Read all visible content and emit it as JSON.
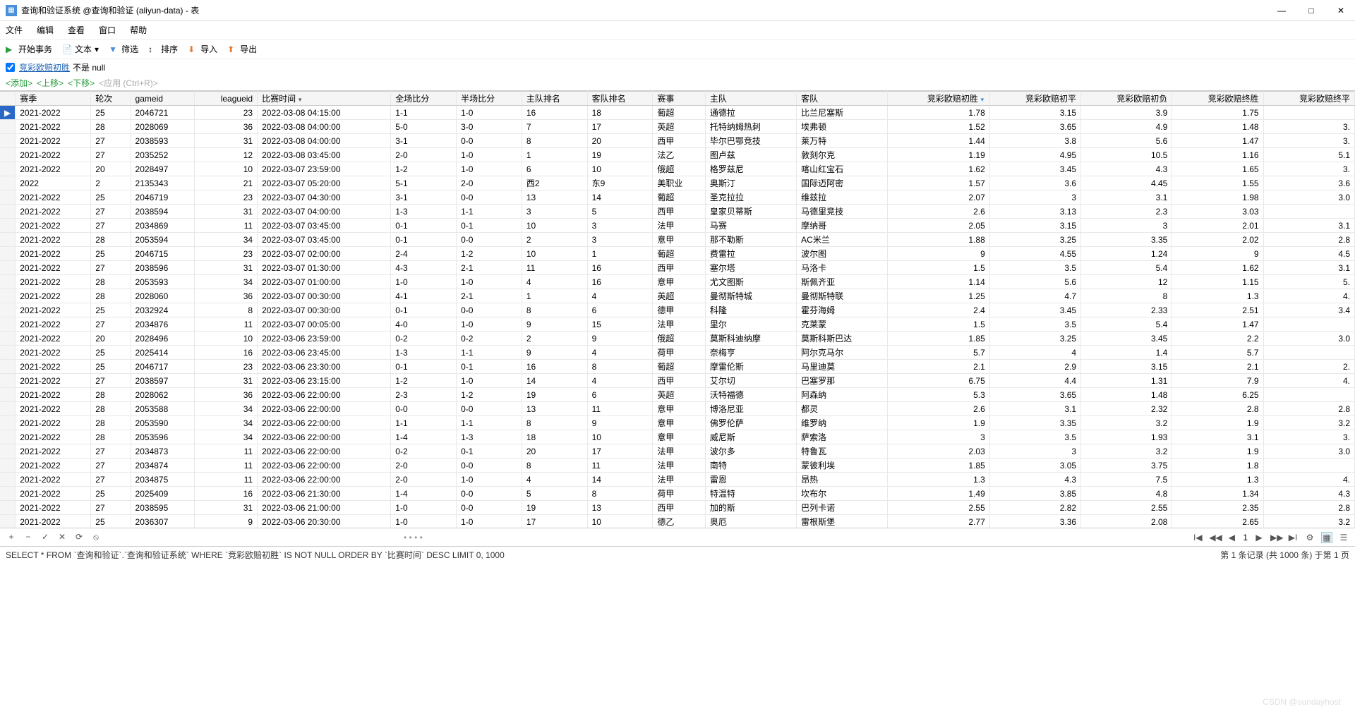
{
  "title": "查询和验证系统 @查询和验证 (aliyun-data) - 表",
  "menu": {
    "file": "文件",
    "edit": "编辑",
    "view": "查看",
    "window": "窗口",
    "help": "帮助"
  },
  "toolbar": {
    "begin": "开始事务",
    "text": "文本",
    "filter": "筛选",
    "sort": "排序",
    "import": "导入",
    "export": "导出"
  },
  "filterbar": {
    "col": "竞彩欧赔初胜",
    "cond": "不是 null"
  },
  "actions": {
    "add": "<添加>",
    "up": "<上移>",
    "down": "<下移>",
    "apply": "<应用 (Ctrl+R)>"
  },
  "columns": [
    "赛季",
    "轮次",
    "gameid",
    "leagueid",
    "比赛时间",
    "全场比分",
    "半场比分",
    "主队排名",
    "客队排名",
    "赛事",
    "主队",
    "客队",
    "竞彩欧赔初胜",
    "竞彩欧赔初平",
    "竞彩欧赔初负",
    "竞彩欧赔终胜",
    "竞彩欧赔终平"
  ],
  "sortCol": 4,
  "filterCol": 12,
  "rows": [
    [
      "2021-2022",
      "25",
      "2046721",
      "23",
      "2022-03-08 04:15:00",
      "1-1",
      "1-0",
      "16",
      "18",
      "葡超",
      "通德拉",
      "比兰尼塞斯",
      "1.78",
      "3.15",
      "3.9",
      "1.75",
      ""
    ],
    [
      "2021-2022",
      "28",
      "2028069",
      "36",
      "2022-03-08 04:00:00",
      "5-0",
      "3-0",
      "7",
      "17",
      "英超",
      "托特纳姆热刺",
      "埃弗顿",
      "1.52",
      "3.65",
      "4.9",
      "1.48",
      "3."
    ],
    [
      "2021-2022",
      "27",
      "2038593",
      "31",
      "2022-03-08 04:00:00",
      "3-1",
      "0-0",
      "8",
      "20",
      "西甲",
      "毕尔巴鄂竞技",
      "莱万特",
      "1.44",
      "3.8",
      "5.6",
      "1.47",
      "3."
    ],
    [
      "2021-2022",
      "27",
      "2035252",
      "12",
      "2022-03-08 03:45:00",
      "2-0",
      "1-0",
      "1",
      "19",
      "法乙",
      "图卢兹",
      "敦刻尔克",
      "1.19",
      "4.95",
      "10.5",
      "1.16",
      "5.1"
    ],
    [
      "2021-2022",
      "20",
      "2028497",
      "10",
      "2022-03-07 23:59:00",
      "1-2",
      "1-0",
      "6",
      "10",
      "俄超",
      "格罗兹尼",
      "喀山红宝石",
      "1.62",
      "3.45",
      "4.3",
      "1.65",
      "3."
    ],
    [
      "2022",
      "2",
      "2135343",
      "21",
      "2022-03-07 05:20:00",
      "5-1",
      "2-0",
      "西2",
      "东9",
      "美职业",
      "奥斯汀",
      "国际迈阿密",
      "1.57",
      "3.6",
      "4.45",
      "1.55",
      "3.6"
    ],
    [
      "2021-2022",
      "25",
      "2046719",
      "23",
      "2022-03-07 04:30:00",
      "3-1",
      "0-0",
      "13",
      "14",
      "葡超",
      "圣克拉拉",
      "维兹拉",
      "2.07",
      "3",
      "3.1",
      "1.98",
      "3.0"
    ],
    [
      "2021-2022",
      "27",
      "2038594",
      "31",
      "2022-03-07 04:00:00",
      "1-3",
      "1-1",
      "3",
      "5",
      "西甲",
      "皇家贝蒂斯",
      "马德里竞技",
      "2.6",
      "3.13",
      "2.3",
      "3.03",
      ""
    ],
    [
      "2021-2022",
      "27",
      "2034869",
      "11",
      "2022-03-07 03:45:00",
      "0-1",
      "0-1",
      "10",
      "3",
      "法甲",
      "马赛",
      "摩纳哥",
      "2.05",
      "3.15",
      "3",
      "2.01",
      "3.1"
    ],
    [
      "2021-2022",
      "28",
      "2053594",
      "34",
      "2022-03-07 03:45:00",
      "0-1",
      "0-0",
      "2",
      "3",
      "意甲",
      "那不勒斯",
      "AC米兰",
      "1.88",
      "3.25",
      "3.35",
      "2.02",
      "2.8"
    ],
    [
      "2021-2022",
      "25",
      "2046715",
      "23",
      "2022-03-07 02:00:00",
      "2-4",
      "1-2",
      "10",
      "1",
      "葡超",
      "费雷拉",
      "波尔图",
      "9",
      "4.55",
      "1.24",
      "9",
      "4.5"
    ],
    [
      "2021-2022",
      "27",
      "2038596",
      "31",
      "2022-03-07 01:30:00",
      "4-3",
      "2-1",
      "11",
      "16",
      "西甲",
      "塞尔塔",
      "马洛卡",
      "1.5",
      "3.5",
      "5.4",
      "1.62",
      "3.1"
    ],
    [
      "2021-2022",
      "28",
      "2053593",
      "34",
      "2022-03-07 01:00:00",
      "1-0",
      "1-0",
      "4",
      "16",
      "意甲",
      "尤文图斯",
      "斯佩齐亚",
      "1.14",
      "5.6",
      "12",
      "1.15",
      "5."
    ],
    [
      "2021-2022",
      "28",
      "2028060",
      "36",
      "2022-03-07 00:30:00",
      "4-1",
      "2-1",
      "1",
      "4",
      "英超",
      "曼彻斯特城",
      "曼彻斯特联",
      "1.25",
      "4.7",
      "8",
      "1.3",
      "4."
    ],
    [
      "2021-2022",
      "25",
      "2032924",
      "8",
      "2022-03-07 00:30:00",
      "0-1",
      "0-0",
      "8",
      "6",
      "德甲",
      "科隆",
      "霍芬海姆",
      "2.4",
      "3.45",
      "2.33",
      "2.51",
      "3.4"
    ],
    [
      "2021-2022",
      "27",
      "2034876",
      "11",
      "2022-03-07 00:05:00",
      "4-0",
      "1-0",
      "9",
      "15",
      "法甲",
      "里尔",
      "克莱蒙",
      "1.5",
      "3.5",
      "5.4",
      "1.47",
      ""
    ],
    [
      "2021-2022",
      "20",
      "2028496",
      "10",
      "2022-03-06 23:59:00",
      "0-2",
      "0-2",
      "2",
      "9",
      "俄超",
      "莫斯科迪纳摩",
      "莫斯科斯巴达",
      "1.85",
      "3.25",
      "3.45",
      "2.2",
      "3.0"
    ],
    [
      "2021-2022",
      "25",
      "2025414",
      "16",
      "2022-03-06 23:45:00",
      "1-3",
      "1-1",
      "9",
      "4",
      "荷甲",
      "奈梅亨",
      "阿尔克马尔",
      "5.7",
      "4",
      "1.4",
      "5.7",
      ""
    ],
    [
      "2021-2022",
      "25",
      "2046717",
      "23",
      "2022-03-06 23:30:00",
      "0-1",
      "0-1",
      "16",
      "8",
      "葡超",
      "摩雷伦斯",
      "马里迪莫",
      "2.1",
      "2.9",
      "3.15",
      "2.1",
      "2."
    ],
    [
      "2021-2022",
      "27",
      "2038597",
      "31",
      "2022-03-06 23:15:00",
      "1-2",
      "1-0",
      "14",
      "4",
      "西甲",
      "艾尔切",
      "巴塞罗那",
      "6.75",
      "4.4",
      "1.31",
      "7.9",
      "4."
    ],
    [
      "2021-2022",
      "28",
      "2028062",
      "36",
      "2022-03-06 22:00:00",
      "2-3",
      "1-2",
      "19",
      "6",
      "英超",
      "沃特福德",
      "阿森纳",
      "5.3",
      "3.65",
      "1.48",
      "6.25",
      ""
    ],
    [
      "2021-2022",
      "28",
      "2053588",
      "34",
      "2022-03-06 22:00:00",
      "0-0",
      "0-0",
      "13",
      "11",
      "意甲",
      "博洛尼亚",
      "都灵",
      "2.6",
      "3.1",
      "2.32",
      "2.8",
      "2.8"
    ],
    [
      "2021-2022",
      "28",
      "2053590",
      "34",
      "2022-03-06 22:00:00",
      "1-1",
      "1-1",
      "8",
      "9",
      "意甲",
      "佛罗伦萨",
      "维罗纳",
      "1.9",
      "3.35",
      "3.2",
      "1.9",
      "3.2"
    ],
    [
      "2021-2022",
      "28",
      "2053596",
      "34",
      "2022-03-06 22:00:00",
      "1-4",
      "1-3",
      "18",
      "10",
      "意甲",
      "威尼斯",
      "萨索洛",
      "3",
      "3.5",
      "1.93",
      "3.1",
      "3."
    ],
    [
      "2021-2022",
      "27",
      "2034873",
      "11",
      "2022-03-06 22:00:00",
      "0-2",
      "0-1",
      "20",
      "17",
      "法甲",
      "波尔多",
      "特鲁瓦",
      "2.03",
      "3",
      "3.2",
      "1.9",
      "3.0"
    ],
    [
      "2021-2022",
      "27",
      "2034874",
      "11",
      "2022-03-06 22:00:00",
      "2-0",
      "0-0",
      "8",
      "11",
      "法甲",
      "南特",
      "蒙彼利埃",
      "1.85",
      "3.05",
      "3.75",
      "1.8",
      ""
    ],
    [
      "2021-2022",
      "27",
      "2034875",
      "11",
      "2022-03-06 22:00:00",
      "2-0",
      "1-0",
      "4",
      "14",
      "法甲",
      "雷恩",
      "昂热",
      "1.3",
      "4.3",
      "7.5",
      "1.3",
      "4."
    ],
    [
      "2021-2022",
      "25",
      "2025409",
      "16",
      "2022-03-06 21:30:00",
      "1-4",
      "0-0",
      "5",
      "8",
      "荷甲",
      "特温特",
      "坎布尔",
      "1.49",
      "3.85",
      "4.8",
      "1.34",
      "4.3"
    ],
    [
      "2021-2022",
      "27",
      "2038595",
      "31",
      "2022-03-06 21:00:00",
      "1-0",
      "0-0",
      "19",
      "13",
      "西甲",
      "加的斯",
      "巴列卡诺",
      "2.55",
      "2.82",
      "2.55",
      "2.35",
      "2.8"
    ],
    [
      "2021-2022",
      "25",
      "2036307",
      "9",
      "2022-03-06 20:30:00",
      "1-0",
      "1-0",
      "17",
      "10",
      "德乙",
      "奥厄",
      "雷根斯堡",
      "2.77",
      "3.36",
      "2.08",
      "2.65",
      "3.2"
    ]
  ],
  "status": {
    "sql": "SELECT * FROM `查询和验证`.`查询和验证系统` WHERE `竞彩欧赔初胜` IS NOT NULL ORDER BY `比赛时间` DESC LIMIT 0, 1000",
    "record": "第 1 条记录 (共 1000 条) 于第 1 页"
  },
  "nav": {
    "page": "1"
  },
  "watermark": "CSDN @sundayhost"
}
